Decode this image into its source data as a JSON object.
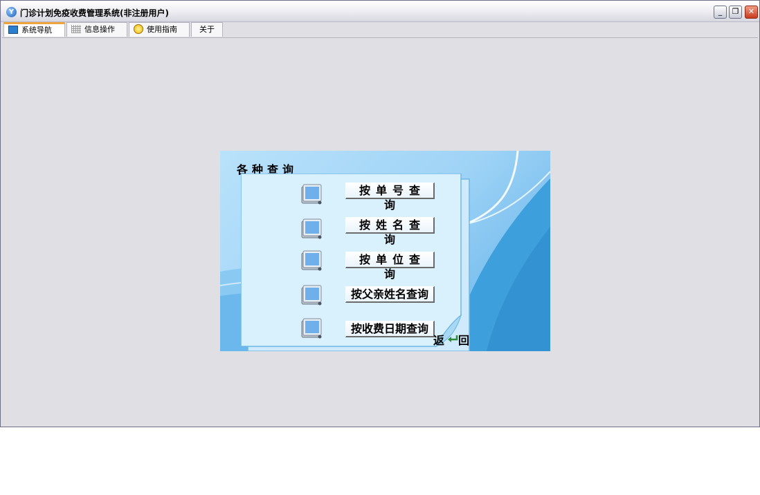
{
  "window": {
    "title": "门诊计划免疫收费管理系统(非注册用户)",
    "controls": {
      "minimize": "_",
      "restore": "❐",
      "close": "✕"
    }
  },
  "tabs": [
    {
      "label": "系统导航",
      "icon": "monitor-icon",
      "active": true
    },
    {
      "label": "信息操作",
      "icon": "grid-icon",
      "active": false
    },
    {
      "label": "使用指南",
      "icon": "guide-icon",
      "active": false
    },
    {
      "label": "关于",
      "icon": "",
      "active": false
    }
  ],
  "query_panel": {
    "title": "各种查询",
    "buttons": [
      {
        "label": "按单号查询",
        "icon": "folder-icon"
      },
      {
        "label": "按姓名查询",
        "icon": "folder-icon"
      },
      {
        "label": "按单位查询",
        "icon": "folder-icon"
      },
      {
        "label": "按父亲姓名查询",
        "icon": "folder-icon"
      },
      {
        "label": "按收费日期查询",
        "icon": "folder-icon"
      }
    ],
    "back": {
      "char1": "返",
      "char2": "回",
      "icon": "return-arrow-icon"
    }
  },
  "colors": {
    "window_bg": "#e0dfe3",
    "panel_light": "#b9e2fb",
    "panel_dark": "#3d9fdc",
    "tab_accent": "#f0a53c"
  }
}
